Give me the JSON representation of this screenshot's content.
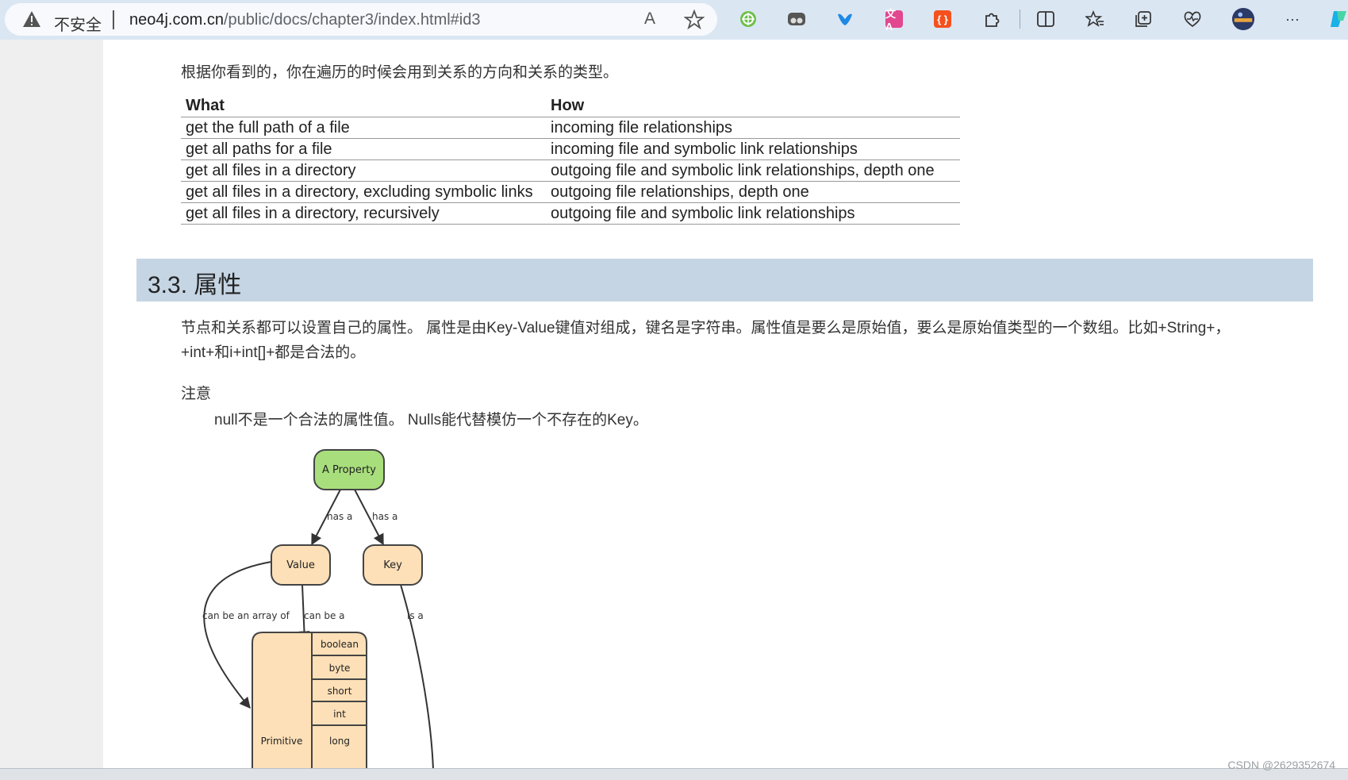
{
  "browser": {
    "insecure_label": "不安全",
    "url_host": "neo4j.com.cn",
    "url_path": "/public/docs/chapter3/index.html#id3",
    "read_aloud_glyph": "A",
    "icons": [
      "warning-icon",
      "read-aloud-icon",
      "favorite-star-icon",
      "extension-icon",
      "extension-icon",
      "extension-icon",
      "translate-extension-icon",
      "code-extension-icon",
      "extensions-puzzle-icon",
      "split-screen-icon",
      "favorites-icon",
      "collections-icon",
      "browser-essentials-icon",
      "profile-avatar",
      "more-icon",
      "copilot-icon"
    ],
    "ext_translate_label": "文A",
    "ext_code_label": "{ }",
    "more_label": "···"
  },
  "content": {
    "intro": "根据你看到的，你在遍历的时候会用到关系的方向和关系的类型。",
    "table": {
      "headers": [
        "What",
        "How"
      ],
      "rows": [
        [
          "get the full path of a file",
          "incoming file relationships"
        ],
        [
          "get all paths for a file",
          "incoming file and symbolic link relationships"
        ],
        [
          "get all files in a directory",
          "outgoing file and symbolic link relationships, depth one"
        ],
        [
          "get all files in a directory, excluding symbolic links",
          "outgoing file relationships, depth one"
        ],
        [
          "get all files in a directory, recursively",
          "outgoing file and symbolic link relationships"
        ]
      ]
    },
    "section_title": "3.3. 属性",
    "paragraph": "节点和关系都可以设置自己的属性。 属性是由Key-Value键值对组成，键名是字符串。属性值是要么是原始值，要么是原始值类型的一个数组。比如+String+，+int+和i+int[]+都是合法的。",
    "note_label": "注意",
    "note_text": "null不是一个合法的属性值。 Nulls能代替模仿一个不存在的Key。"
  },
  "diagram": {
    "nodes": {
      "property": "A Property",
      "value": "Value",
      "key": "Key",
      "primitive": "Primitive"
    },
    "edges": {
      "has_a_1": "has a",
      "has_a_2": "has a",
      "array_of": "can be an array of",
      "can_be": "can be a",
      "is_a": "is a"
    },
    "types": [
      "boolean",
      "byte",
      "short",
      "int",
      "long"
    ],
    "colors": {
      "property_fill": "#a8df7c",
      "node_fill": "#fde0b8",
      "stroke": "#444444"
    }
  },
  "watermark": "CSDN @2629352674"
}
